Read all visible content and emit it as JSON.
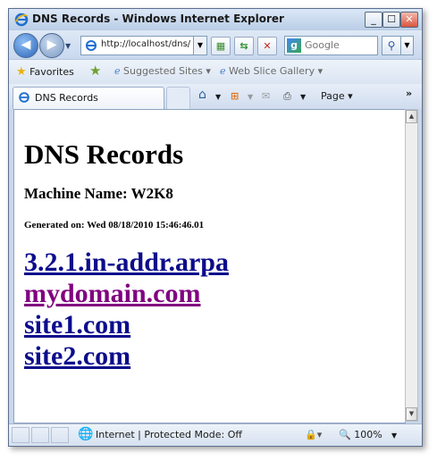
{
  "window": {
    "title": "DNS Records - Windows Internet Explorer"
  },
  "nav": {
    "address": "http://localhost/dns/",
    "search_placeholder": "Google"
  },
  "favorites": {
    "label": "Favorites",
    "suggested": "Suggested Sites ▾",
    "gallery": "Web Slice Gallery ▾"
  },
  "tab": {
    "label": "DNS Records"
  },
  "command": {
    "page": "Page ▾"
  },
  "page": {
    "title": "DNS Records",
    "machine": "Machine Name: W2K8",
    "generated": "Generated on: Wed 08/18/2010 15:46:46.01",
    "links": [
      "3.2.1.in-addr.arpa",
      "mydomain.com",
      "site1.com",
      "site2.com"
    ]
  },
  "status": {
    "zone": "Internet | Protected Mode: Off",
    "zoom": "100%"
  },
  "colors": {
    "link": "#0c0c8c",
    "visited_link": "#800080",
    "chrome": "#c9d7ea"
  }
}
